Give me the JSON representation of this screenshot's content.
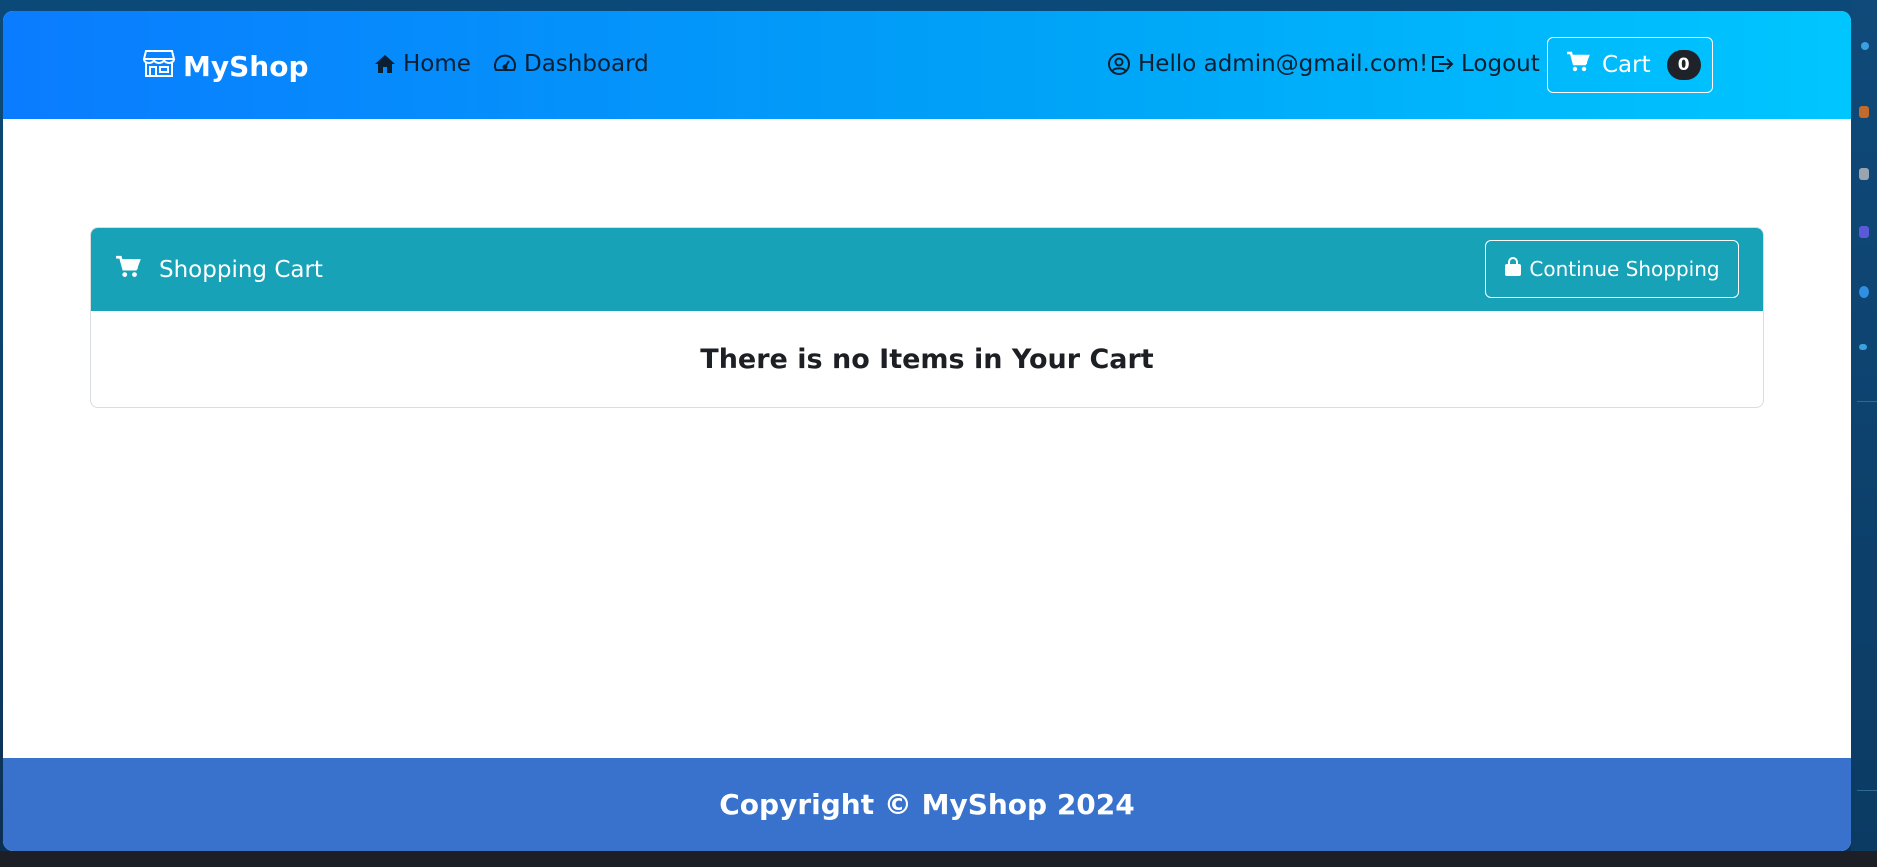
{
  "navbar": {
    "brand": "MyShop",
    "links": [
      {
        "label": "Home",
        "icon": "house-icon"
      },
      {
        "label": "Dashboard",
        "icon": "speedometer-icon"
      }
    ],
    "greeting": "Hello admin@gmail.com!",
    "logout_label": "Logout",
    "cart_label": "Cart",
    "cart_count": "0"
  },
  "cart": {
    "title": "Shopping Cart",
    "continue_label": "Continue Shopping",
    "empty_message": "There is no Items in Your Cart"
  },
  "footer": {
    "text": "Copyright © MyShop 2024"
  },
  "colors": {
    "navbar_gradient_start": "#0a7cff",
    "navbar_gradient_end": "#00c6ff",
    "card_header": "#17a2b8",
    "footer": "#3872cc",
    "badge": "#1f2329"
  }
}
